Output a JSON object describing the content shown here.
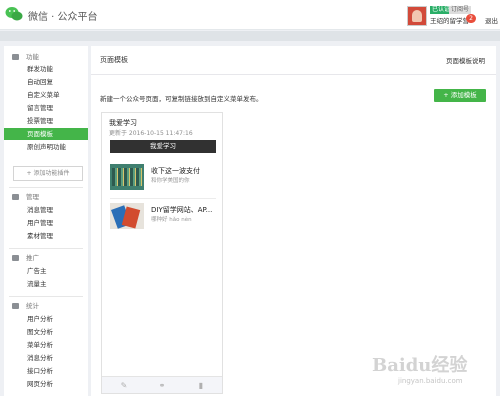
{
  "header": {
    "title": "微信 · 公众平台",
    "tag1": "已认证",
    "tag2": "订阅号",
    "username": "王绍的留学营",
    "notification_count": "2",
    "logout": "退出"
  },
  "sidebar": {
    "categories": [
      {
        "label": "功能",
        "items": [
          "群发功能",
          "自动回复",
          "自定义菜单",
          "留言管理",
          "投票管理",
          "页面模板",
          "原创声明功能"
        ]
      },
      {
        "label": "管理",
        "items": [
          "消息管理",
          "用户管理",
          "素材管理"
        ]
      },
      {
        "label": "推广",
        "items": [
          "广告主",
          "流量主"
        ]
      },
      {
        "label": "统计",
        "items": [
          "用户分析",
          "图文分析",
          "菜单分析",
          "消息分析",
          "接口分析",
          "网页分析"
        ]
      }
    ],
    "add_plugin": "+ 添加功能插件",
    "active_item": "页面模板"
  },
  "main": {
    "title": "页面模板",
    "help": "页面模板说明",
    "description": "新建一个公众号页面，可复制链接放到自定义菜单发布。",
    "add_button": "+ 添加模板"
  },
  "card": {
    "title": "我爱学习",
    "date": "更新于 2016-10-15 11:47:16",
    "bar_label": "我爱学习",
    "articles": [
      {
        "title": "收下这一波支付",
        "subtitle": "和你学美国的你"
      },
      {
        "title": "DIY留学网站、AP...",
        "subtitle": "哪种好 hǎo nèn"
      }
    ]
  },
  "icons": {
    "edit": "pencil-icon",
    "link": "link-icon",
    "delete": "trash-icon"
  },
  "watermark": {
    "text": "Baidu经验",
    "url": "jingyan.baidu.com"
  },
  "colors": {
    "accent": "#44b549",
    "logo": "#49c254"
  }
}
